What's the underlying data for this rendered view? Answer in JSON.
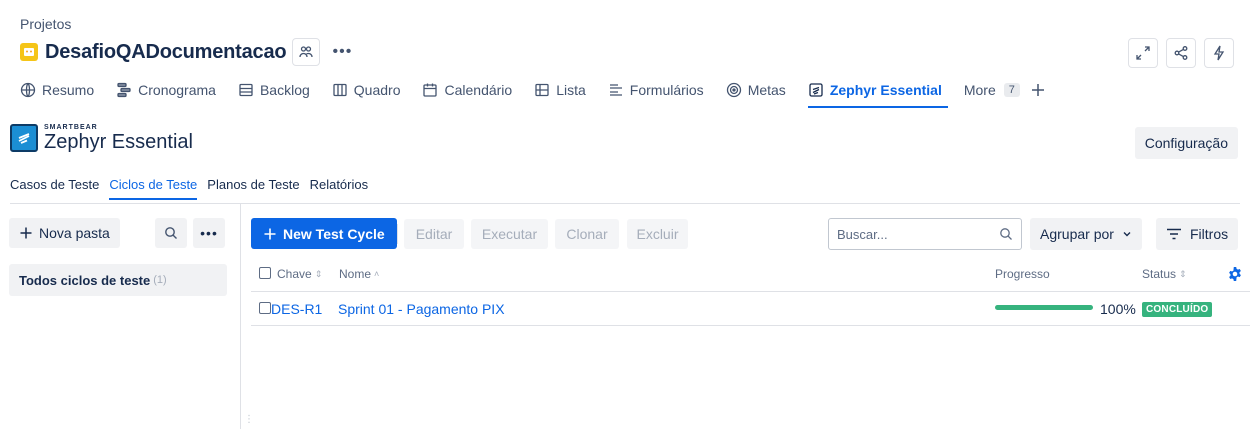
{
  "header": {
    "breadcrumb": "Projetos",
    "project_title": "DesafioQADocumentacao"
  },
  "nav": {
    "tabs": [
      {
        "label": "Resumo",
        "icon": "globe-icon"
      },
      {
        "label": "Cronograma",
        "icon": "timeline-icon"
      },
      {
        "label": "Backlog",
        "icon": "backlog-icon"
      },
      {
        "label": "Quadro",
        "icon": "board-icon"
      },
      {
        "label": "Calendário",
        "icon": "calendar-icon"
      },
      {
        "label": "Lista",
        "icon": "list-icon"
      },
      {
        "label": "Formulários",
        "icon": "form-icon"
      },
      {
        "label": "Metas",
        "icon": "goal-icon"
      },
      {
        "label": "Zephyr Essential",
        "icon": "zephyr-icon",
        "active": true
      }
    ],
    "more_label": "More",
    "more_count": "7"
  },
  "zephyr": {
    "brand": "SMARTBEAR",
    "name": "Zephyr Essential",
    "config_label": "Configuração"
  },
  "subtabs": [
    {
      "label": "Casos de Teste"
    },
    {
      "label": "Ciclos de Teste",
      "active": true
    },
    {
      "label": "Planos de Teste"
    },
    {
      "label": "Relatórios"
    }
  ],
  "sidebar": {
    "new_folder_label": "Nova pasta",
    "all_cycles_label": "Todos ciclos de teste",
    "all_cycles_count": "(1)"
  },
  "toolbar": {
    "new_cycle_label": "New Test Cycle",
    "edit_label": "Editar",
    "execute_label": "Executar",
    "clone_label": "Clonar",
    "delete_label": "Excluir",
    "search_placeholder": "Buscar...",
    "group_by_label": "Agrupar por",
    "filters_label": "Filtros"
  },
  "table": {
    "columns": {
      "key": "Chave",
      "name": "Nome",
      "progress": "Progresso",
      "status": "Status"
    },
    "rows": [
      {
        "key": "DES-R1",
        "name": "Sprint 01 - Pagamento PIX",
        "progress_percent": 100,
        "progress_label": "100%",
        "status": "CONCLUÍDO"
      }
    ]
  },
  "colors": {
    "accent": "#0c66e4",
    "success": "#36b37e"
  }
}
